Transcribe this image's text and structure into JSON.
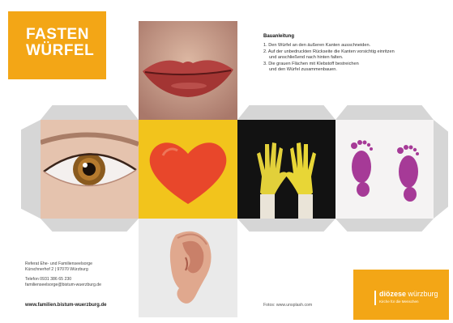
{
  "title": {
    "line1": "FASTEN",
    "line2": "WÜRFEL"
  },
  "instructions": {
    "heading": "Bauanleitung",
    "steps": [
      "1. Den Würfel an den äußeren Kanten ausschneiden.",
      "2. Auf der unbedruckten Rückseite die Kanten vorsichtig einritzen",
      "und anschließend nach hinten falten.",
      "3. Die grauen Flächen mit Klebstoff bestreichen",
      "und den Würfel zusammenbauen."
    ]
  },
  "faces": [
    {
      "name": "mouth-face"
    },
    {
      "name": "eye-face"
    },
    {
      "name": "heart-face"
    },
    {
      "name": "hands-face"
    },
    {
      "name": "feet-face"
    },
    {
      "name": "ear-face"
    }
  ],
  "address": {
    "org": "Referat Ehe- und Familienseelsorge",
    "street": "Kürschnerhof 2 | 97070 Würzburg",
    "phone": "Telefon 0931 386 65 230",
    "email": "familienseelsorge@bistum-wuerzburg.de",
    "website": "www.familien.bistum-wuerzburg.de"
  },
  "credits": "Fotos: www.unsplash.com",
  "diocese": {
    "name_bold": "diözese",
    "name_light": "würzburg",
    "tagline": "Kirche für die Menschen"
  },
  "colors": {
    "accent": "#f3a616",
    "tab_gray": "#d6d6d6"
  }
}
